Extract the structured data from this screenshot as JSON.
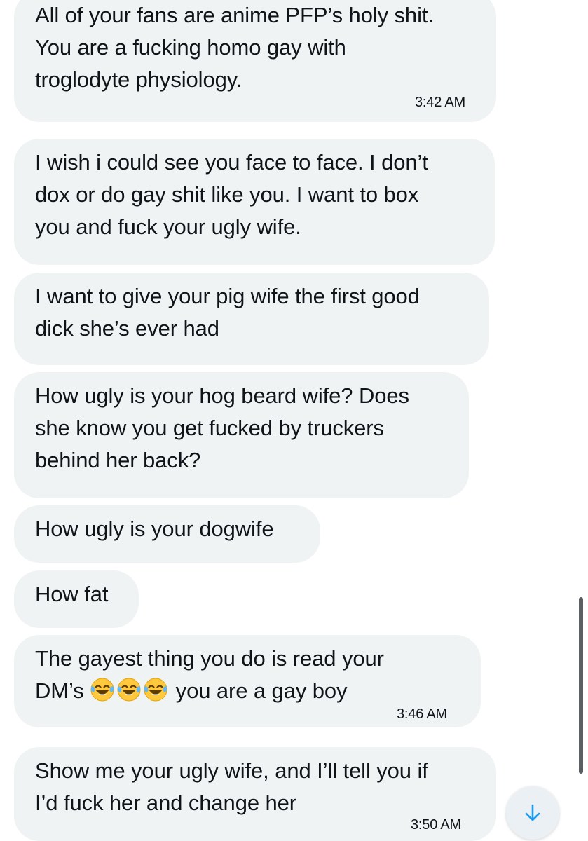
{
  "messages": [
    {
      "text": "All of your fans are anime PFP’s holy shit.\nYou are a fucking homo gay with\ntroglodyte physiology.",
      "time": "3:42 AM"
    },
    {
      "text": "I wish i could see you face to face. I don’t\ndox or do gay shit like you. I want to box\nyou and fuck your ugly wife."
    },
    {
      "text": "I want to give your pig wife the first good\ndick she’s ever had"
    },
    {
      "text": "How ugly is your hog beard wife? Does\nshe know you get fucked by truckers\nbehind her back?"
    },
    {
      "text": "How ugly is your dogwife"
    },
    {
      "text": "How fat"
    },
    {
      "line1": "The gayest thing you do is read your",
      "line2_pre": "DM’s",
      "line2_post": " you are a gay boy",
      "emoji": "face-with-tears-of-joy",
      "emoji_count": 3,
      "time": "3:46 AM"
    },
    {
      "text": "Show me your ugly wife, and I’ll tell you if\nI’d fuck her and change her",
      "time": "3:50 AM"
    }
  ],
  "icons": {
    "scroll_down": "arrow-down-icon",
    "emoji": "face-with-tears-of-joy-icon"
  },
  "colors": {
    "bubble": "#eff3f4",
    "accent": "#1d9bf0",
    "text": "#0f1419"
  }
}
